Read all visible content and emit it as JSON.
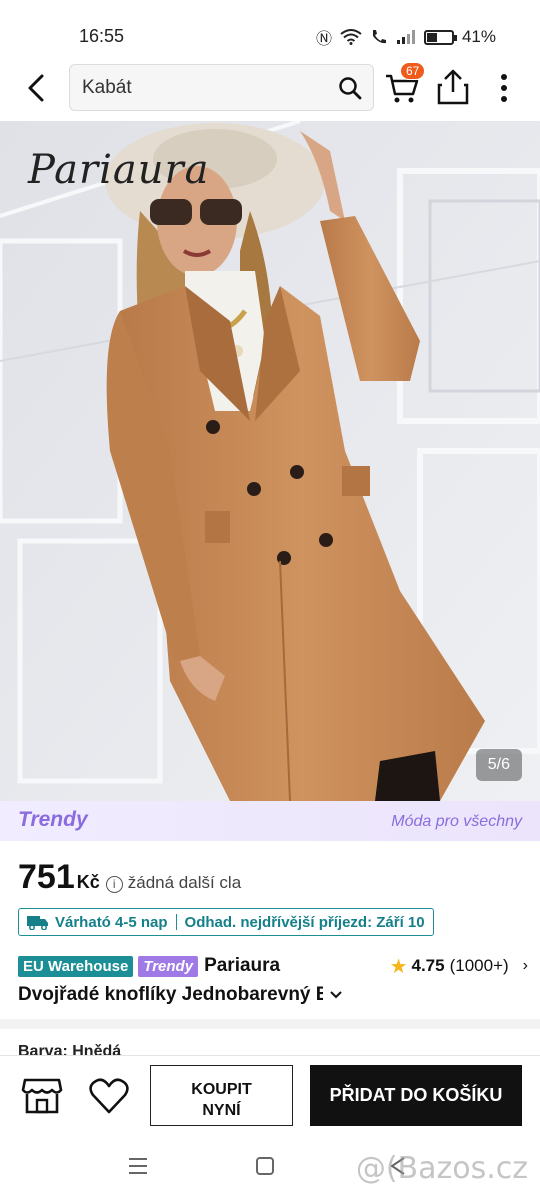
{
  "status": {
    "time": "16:55",
    "battery": "41%",
    "battery_level": 0.41
  },
  "search": {
    "value": "Kabát"
  },
  "cart": {
    "count": "67"
  },
  "image": {
    "brand_logo": "Pariaura",
    "counter": "5/6"
  },
  "banner": {
    "logo": "Trendy",
    "slogan": "Móda pro všechny"
  },
  "product": {
    "price": "751",
    "currency": "Kč",
    "duty_note": "žádná další cla",
    "delivery_estimate": "Várható 4-5 nap",
    "arrival": "Odhad. nejdřívější příjezd: Září 10",
    "tag_eu": "EU Warehouse",
    "tag_trendy": "Trendy",
    "brand": "Pariaura",
    "rating": "4.75",
    "rating_count": "(1000+)",
    "title": "Dvojřadé knoflíky Jednobarevný E",
    "color_label": "Barva: Hnědá"
  },
  "actions": {
    "buy_line1": "KOUPIT",
    "buy_line2": "NYNÍ",
    "add_to_cart": "PŘIDAT DO KOŠÍKU"
  },
  "watermark": "@(Bazos.cz",
  "colors": {
    "coat": "#c98a55",
    "accent_teal": "#1b8f95",
    "trendy_purple": "#9f7ae6",
    "badge_orange": "#f05a1a"
  }
}
